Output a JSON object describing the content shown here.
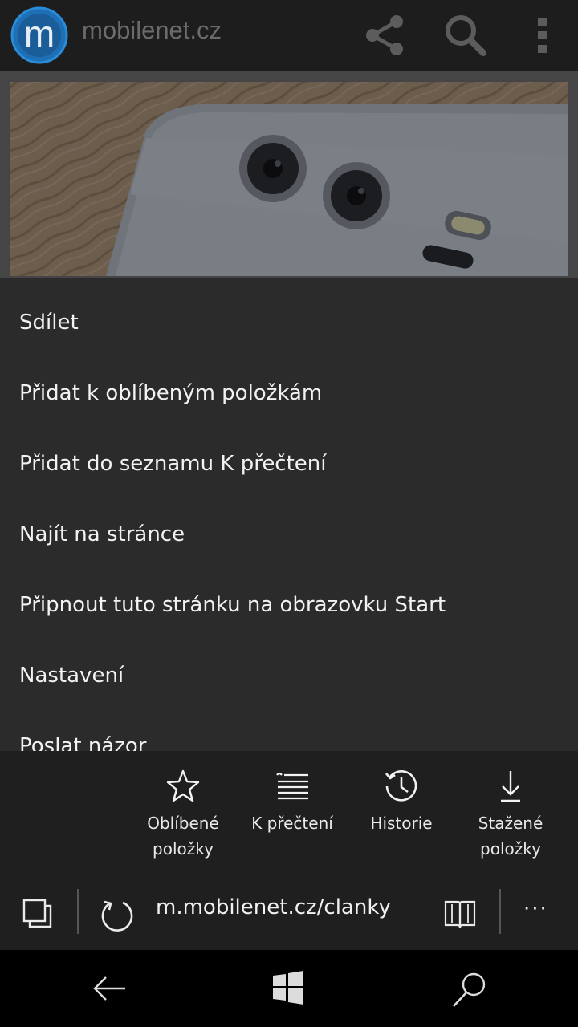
{
  "site": {
    "name": "mobilenet.cz",
    "logo_letter": "m",
    "icons": [
      "share-icon",
      "search-icon",
      "more-vertical-icon"
    ]
  },
  "hero": {
    "icon": "phone-camera-photo"
  },
  "menu": {
    "items": [
      "Sdílet",
      "Přidat k oblíbeným položkám",
      "Přidat do seznamu K přečtení",
      "Najít na stránce",
      "Připnout tuto stránku na obrazovku Start",
      "Nastavení",
      "Poslat názor"
    ]
  },
  "hub": {
    "favorites": {
      "line1": "Oblíbené",
      "line2": "položky",
      "icon": "star-icon"
    },
    "reading_list": {
      "line1": "K přečtení",
      "icon": "reading-list-icon"
    },
    "history": {
      "line1": "Historie",
      "icon": "history-icon"
    },
    "downloads": {
      "line1": "Stažené",
      "line2": "položky",
      "icon": "download-icon"
    }
  },
  "address_bar": {
    "url": "m.mobilenet.cz/clanky",
    "more_label": "···",
    "icons": [
      "tabs-icon",
      "refresh-icon",
      "reading-view-icon"
    ]
  },
  "navigation": {
    "icons": [
      "back-arrow-icon",
      "windows-start-icon",
      "search-icon"
    ]
  },
  "colors": {
    "header_bg": "#1d1d1d",
    "menu_bg": "#2b2b2b",
    "hub_bg": "#1f1f1f",
    "logo_blue": "#1e6fb5"
  }
}
